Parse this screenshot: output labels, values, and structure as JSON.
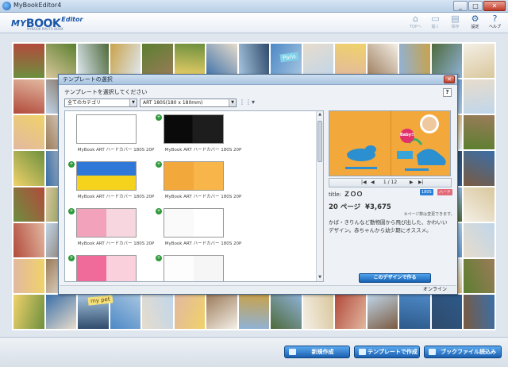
{
  "window": {
    "title": "MyBookEditor4",
    "minimize": "_",
    "maximize": "□",
    "close": "✕"
  },
  "logo": {
    "my": "MY",
    "book": "BOOK",
    "editor": "Editor",
    "tagline": "MYBOOK PHOTO BOOK"
  },
  "toolbar": [
    {
      "icon": "home-icon",
      "glyph": "⌂",
      "label": "TOPへ",
      "enabled": false
    },
    {
      "icon": "open-icon",
      "glyph": "▭",
      "label": "開く",
      "enabled": false
    },
    {
      "icon": "save-icon",
      "glyph": "▤",
      "label": "保存",
      "enabled": false
    },
    {
      "icon": "gear-icon",
      "glyph": "⚙",
      "label": "設定",
      "enabled": true
    },
    {
      "icon": "help-icon",
      "glyph": "?",
      "label": "ヘルプ",
      "enabled": true
    }
  ],
  "dialog": {
    "title": "テンプレートの選択",
    "instruction": "テンプレートを選択してください",
    "help": "?",
    "category_select": "全てのカテゴリ",
    "product_select": "ART 180S(180 x 180mm)",
    "view_toggle": "⋮⋮▾",
    "templates": [
      {
        "caption": "MyBook ART ハードカバー 180S 20P",
        "thumb": "black"
      },
      {
        "caption": "MyBook ART ハードカバー 180S 20P",
        "thumb": "night"
      },
      {
        "caption": "MyBook ART ハードカバー 180S 20P",
        "thumb": "blue-yellow"
      },
      {
        "caption": "MyBook ART ハードカバー 180S 20P",
        "thumb": "orange"
      },
      {
        "caption": "MyBook ART ハードカバー 180S 20P",
        "thumb": "pink"
      },
      {
        "caption": "MyBook ART ハードカバー 180S 20P",
        "thumb": "white"
      },
      {
        "caption": "",
        "thumb": "pink2"
      },
      {
        "caption": "",
        "thumb": "white2"
      }
    ],
    "preview": {
      "pager": "1 / 12",
      "title_label": "title:",
      "title": "ＺＯＯ",
      "badge1": "180S",
      "badge2": "ハード",
      "badge1_color": "#2a7fd6",
      "badge2_color": "#e26b7a",
      "pages": "20 ページ",
      "price": "¥3,675",
      "note": "※ページ数は変更できます。",
      "description": "かば・きりんなど動物園から飛び出した、かわいいデザイン。赤ちゃんから幼少期にオススメ。",
      "baby_label": "Baby!!",
      "button": "このデザインで作る"
    },
    "status": "オンライン"
  },
  "bottom": {
    "new": "新規作成",
    "from_template": "テンプレートで作成",
    "load_file": "ブックファイル読込み"
  },
  "mosaic_labels": {
    "paris": "Paris",
    "mypet": "my pet"
  },
  "colors": {
    "accent": "#1a62b4",
    "header_bg": "#e8eef5",
    "preview_bg": "#f3a83c"
  }
}
